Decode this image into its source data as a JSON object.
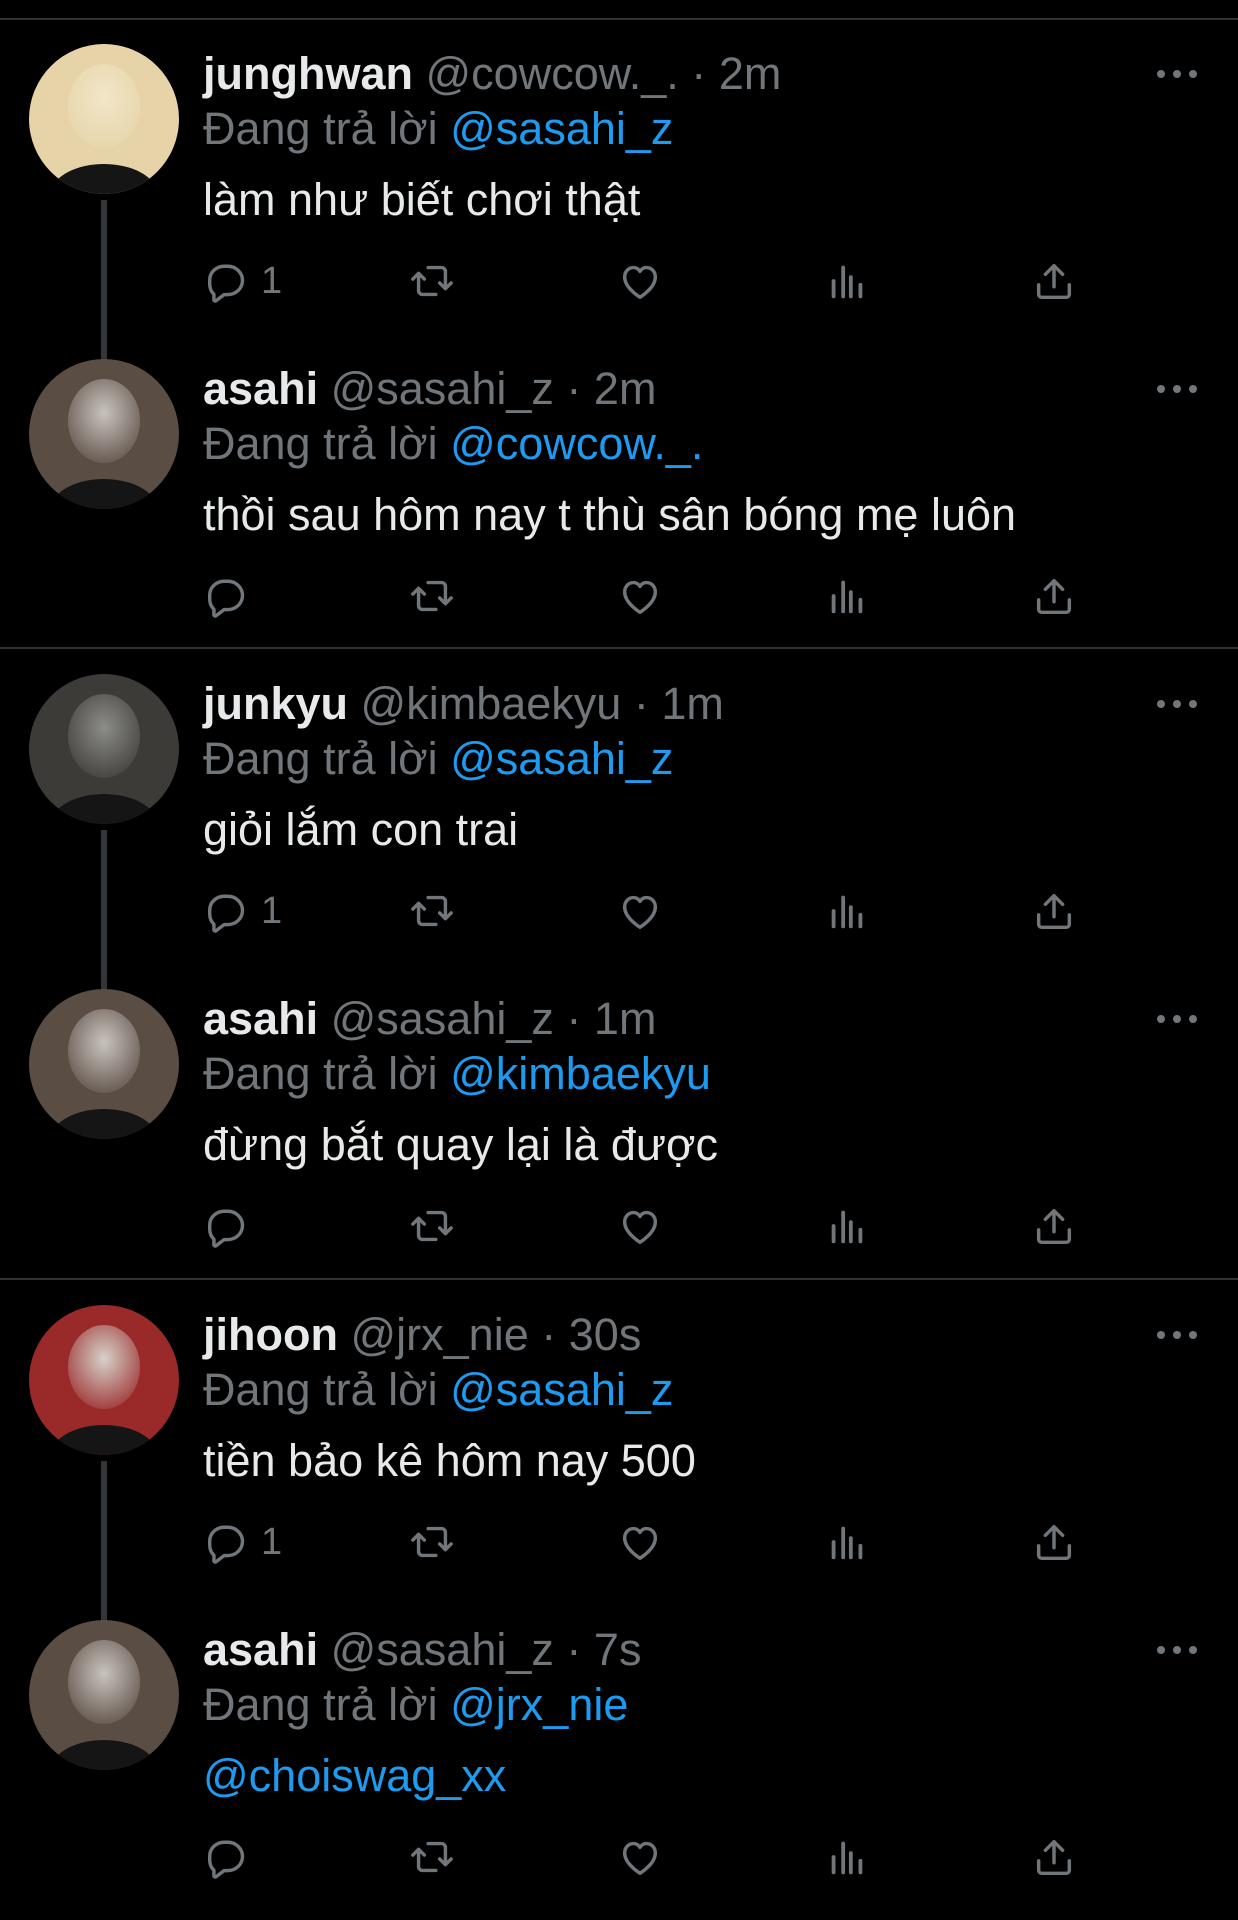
{
  "reply_prefix": "Đang trả lời",
  "threads": [
    {
      "tweets": [
        {
          "name": "junghwan",
          "handle": "@cowcow._.",
          "dot": "·",
          "time": "2m",
          "replying_to": "@sasahi_z",
          "text": "làm như biết chơi thật",
          "text_is_mention": false,
          "reply_count": "1",
          "avatar_colors": [
            "#f2e6c8",
            "#e6d4a8"
          ]
        },
        {
          "name": "asahi",
          "handle": "@sasahi_z",
          "dot": "·",
          "time": "2m",
          "replying_to": "@cowcow._.",
          "text": "thồi sau hôm nay t thù sân bóng mẹ luôn",
          "text_is_mention": false,
          "reply_count": "",
          "avatar_colors": [
            "#c9c3be",
            "#5a4d44"
          ]
        }
      ]
    },
    {
      "tweets": [
        {
          "name": "junkyu",
          "handle": "@kimbaekyu",
          "dot": "·",
          "time": "1m",
          "replying_to": "@sasahi_z",
          "text": "giỏi lắm con trai",
          "text_is_mention": false,
          "reply_count": "1",
          "avatar_colors": [
            "#8c8c88",
            "#3d3b38"
          ]
        },
        {
          "name": "asahi",
          "handle": "@sasahi_z",
          "dot": "·",
          "time": "1m",
          "replying_to": "@kimbaekyu",
          "text": "đừng bắt quay lại là được",
          "text_is_mention": false,
          "reply_count": "",
          "avatar_colors": [
            "#c9c3be",
            "#5a4d44"
          ]
        }
      ]
    },
    {
      "tweets": [
        {
          "name": "jihoon",
          "handle": "@jrx_nie",
          "dot": "·",
          "time": "30s",
          "replying_to": "@sasahi_z",
          "text": "tiền bảo kê hôm nay 500",
          "text_is_mention": false,
          "reply_count": "1",
          "avatar_colors": [
            "#d6d2ca",
            "#9a2a2a"
          ]
        },
        {
          "name": "asahi",
          "handle": "@sasahi_z",
          "dot": "·",
          "time": "7s",
          "replying_to": "@jrx_nie",
          "text": "@choiswag_xx",
          "text_is_mention": true,
          "reply_count": "",
          "avatar_colors": [
            "#c9c3be",
            "#5a4d44"
          ]
        }
      ]
    }
  ],
  "colors": {
    "background": "#000000",
    "text": "#e7e9ea",
    "muted": "#71767b",
    "accent": "#1d9bf0",
    "separator": "#2f3336"
  },
  "icons": [
    "reply-icon",
    "retweet-icon",
    "like-icon",
    "views-icon",
    "share-icon",
    "more-icon"
  ]
}
